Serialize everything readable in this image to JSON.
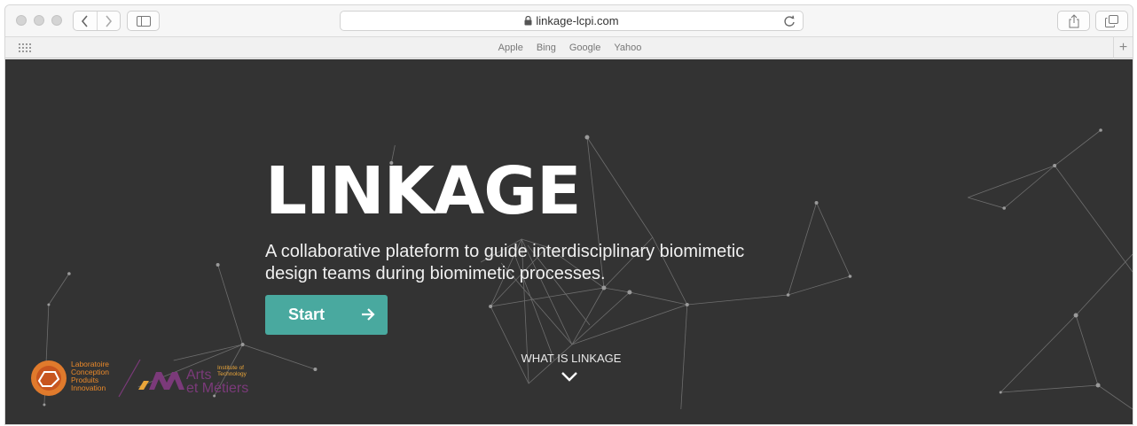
{
  "browser": {
    "url": "linkage-lcpi.com",
    "favorites": [
      "Apple",
      "Bing",
      "Google",
      "Yahoo"
    ],
    "new_tab_label": "+"
  },
  "hero": {
    "title": "LINKAGE",
    "subtitle": "A collaborative plateform to guide interdisciplinary biomimetic design teams during biomimetic processes.",
    "start_label": "Start",
    "what_link": "WHAT IS LINKAGE"
  },
  "logos": {
    "lcpi_lines": [
      "Laboratoire",
      "Conception",
      "Produits",
      "Innovation"
    ],
    "am_word1": "Arts",
    "am_word2": "et Métiers",
    "am_institute": [
      "Institute of",
      "Technology"
    ]
  },
  "colors": {
    "page_background": "#333333",
    "start_button": "#49a99f",
    "lcpi_orange": "#e9892a",
    "am_purple": "#7b3a7a"
  },
  "icons": {
    "back": "chevron-left-icon",
    "forward": "chevron-right-icon",
    "sidebar": "sidebar-icon",
    "lock": "lock-icon",
    "reload": "reload-icon",
    "share": "share-icon",
    "tabs": "tabs-icon",
    "favorites_grid": "grid-icon",
    "start_arrow": "arrow-right-icon",
    "scroll_down": "chevron-down-icon"
  }
}
